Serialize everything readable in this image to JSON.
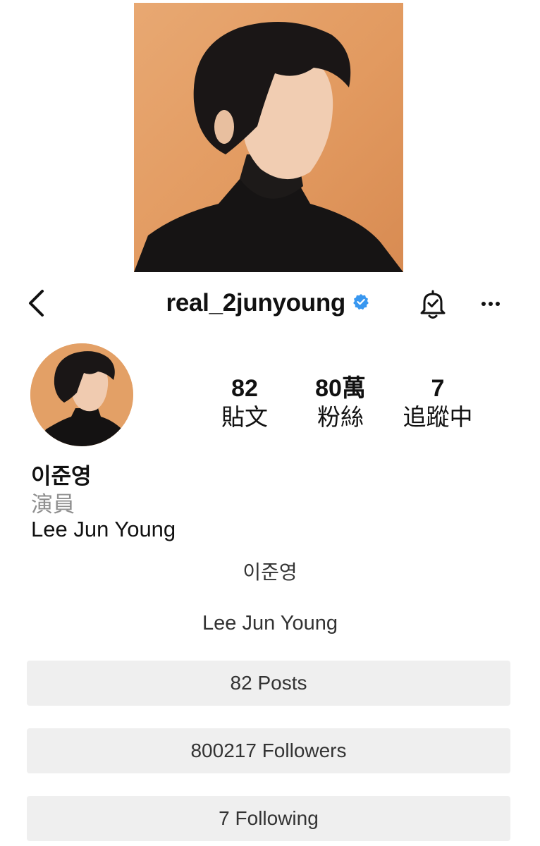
{
  "header": {
    "username": "real_2junyoung",
    "verified_color": "#3897f0"
  },
  "icons": {
    "back": "chevron-left-icon",
    "verified": "verified-badge-icon",
    "notifications": "bell-check-icon",
    "more": "more-horizontal-icon"
  },
  "stats": [
    {
      "value": "82",
      "label": "貼文"
    },
    {
      "value": "80萬",
      "label": "粉絲"
    },
    {
      "value": "7",
      "label": "追蹤中"
    }
  ],
  "profile": {
    "display_name": "이준영",
    "category": "演員",
    "bio": "Lee Jun Young"
  },
  "translation": {
    "name_ko": "이준영",
    "name_en": "Lee Jun Young"
  },
  "buttons": {
    "posts": "82 Posts",
    "followers": "800217 Followers",
    "following": "7 Following"
  }
}
